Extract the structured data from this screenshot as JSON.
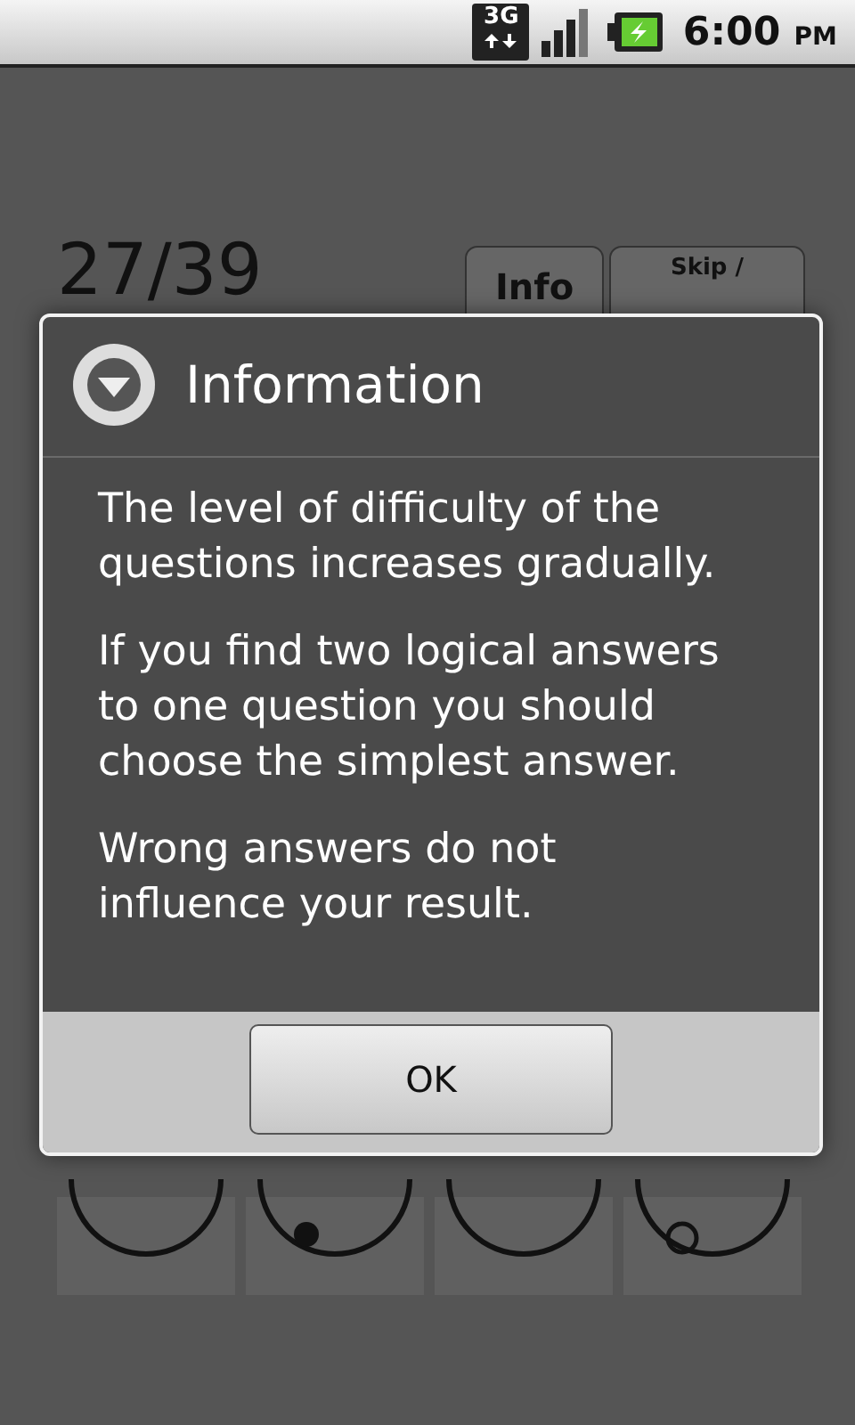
{
  "status_bar": {
    "network": "3G",
    "time": "6:00",
    "meridiem": "PM"
  },
  "screen": {
    "counter": "27/39",
    "buttons": [
      {
        "label": "Info"
      },
      {
        "label": "Skip /"
      }
    ]
  },
  "dialog": {
    "title": "Information",
    "paragraphs": [
      "The level of difficulty of the questions increases gradually.",
      "If you find two logical answers to one question you should choose the simplest answer.",
      "Wrong answers do not influence your result."
    ],
    "button": "OK"
  }
}
